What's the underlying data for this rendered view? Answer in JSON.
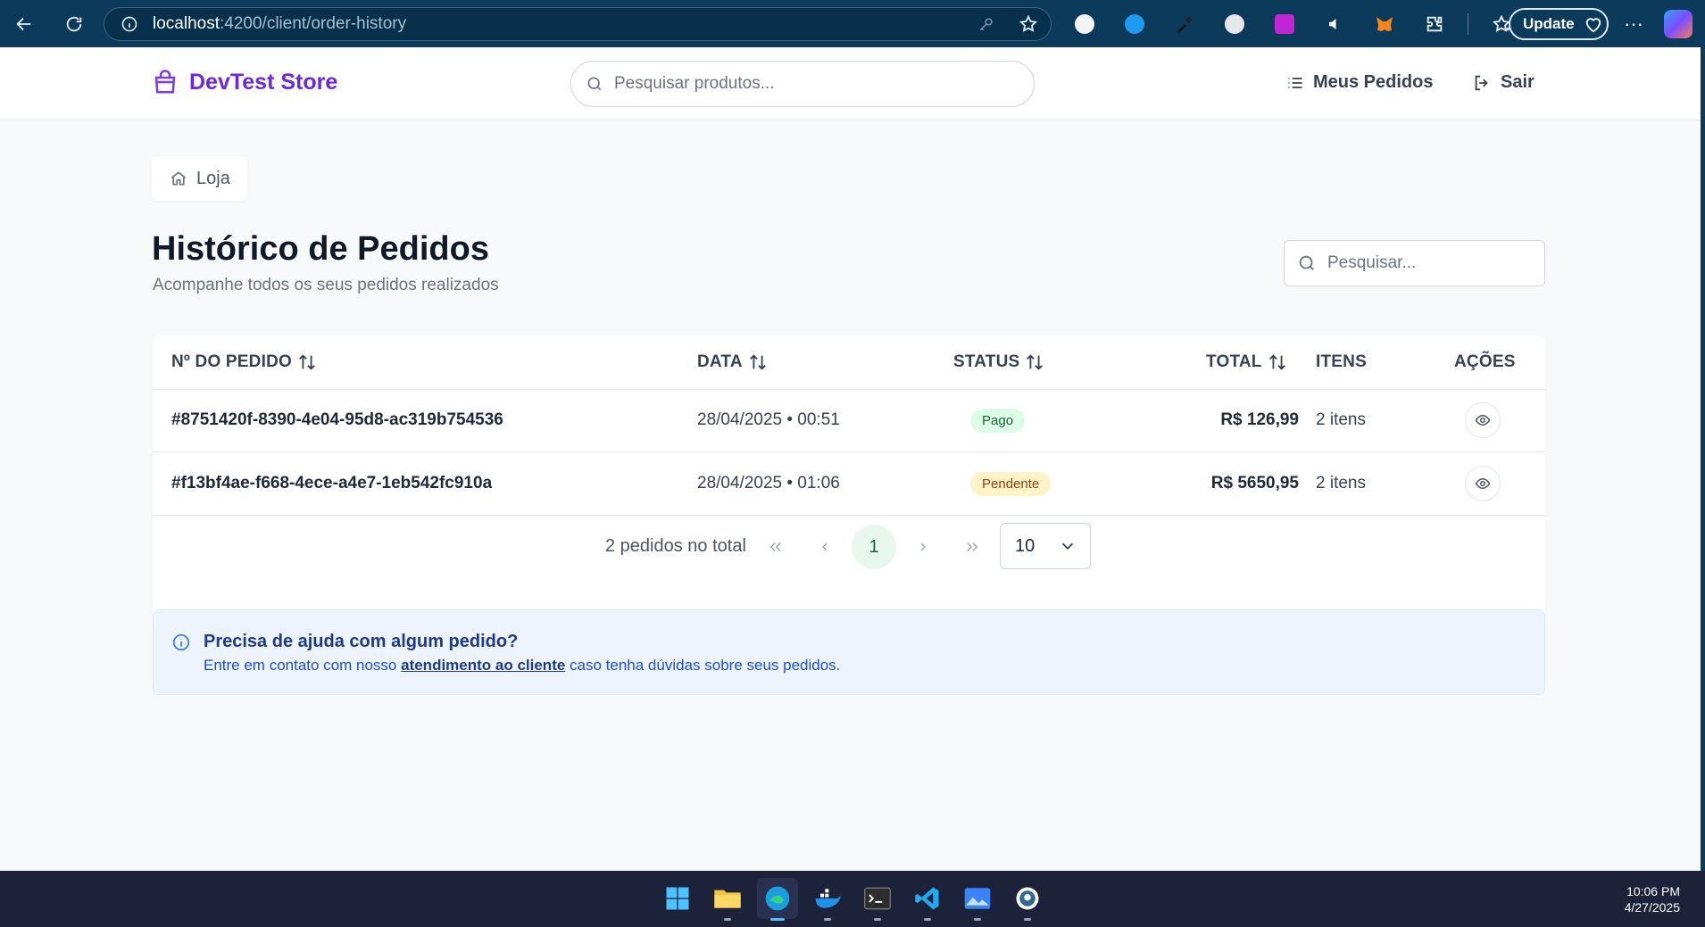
{
  "browser": {
    "url_host": "localhost",
    "url_path": ":4200/client/order-history",
    "update_label": "Update"
  },
  "header": {
    "store_name": "DevTest Store",
    "search_placeholder": "Pesquisar produtos...",
    "orders_link": "Meus Pedidos",
    "logout_link": "Sair"
  },
  "breadcrumb": {
    "label": "Loja"
  },
  "page": {
    "title": "Histórico de Pedidos",
    "subtitle": "Acompanhe todos os seus pedidos realizados",
    "search_placeholder": "Pesquisar..."
  },
  "table": {
    "columns": {
      "order_no": "Nº DO PEDIDO",
      "date": "DATA",
      "status": "STATUS",
      "total": "TOTAL",
      "items": "ITENS",
      "actions": "AÇÕES"
    },
    "rows": [
      {
        "id": "#8751420f-8390-4e04-95d8-ac319b754536",
        "date": "28/04/2025 • 00:51",
        "status": "Pago",
        "total": "R$ 126,99",
        "items": "2 itens"
      },
      {
        "id": "#f13bf4ae-f668-4ece-a4e7-1eb542fc910a",
        "date": "28/04/2025 • 01:06",
        "status": "Pendente",
        "total": "R$ 5650,95",
        "items": "2 itens"
      }
    ]
  },
  "pagination": {
    "total_text": "2 pedidos no total",
    "current_page": "1",
    "page_size": "10"
  },
  "help": {
    "title": "Precisa de ajuda com algum pedido?",
    "text_before": "Entre em contato com nosso ",
    "link_text": "atendimento ao cliente",
    "text_after": " caso tenha dúvidas sobre seus pedidos."
  },
  "taskbar": {
    "time": "10:06 PM",
    "date": "4/27/2025"
  },
  "colors": {
    "brand": "#6d28d9",
    "browser_bar": "#0b3a5b",
    "paid_badge": "#dcfce7",
    "pending_badge": "#fef3c7"
  }
}
